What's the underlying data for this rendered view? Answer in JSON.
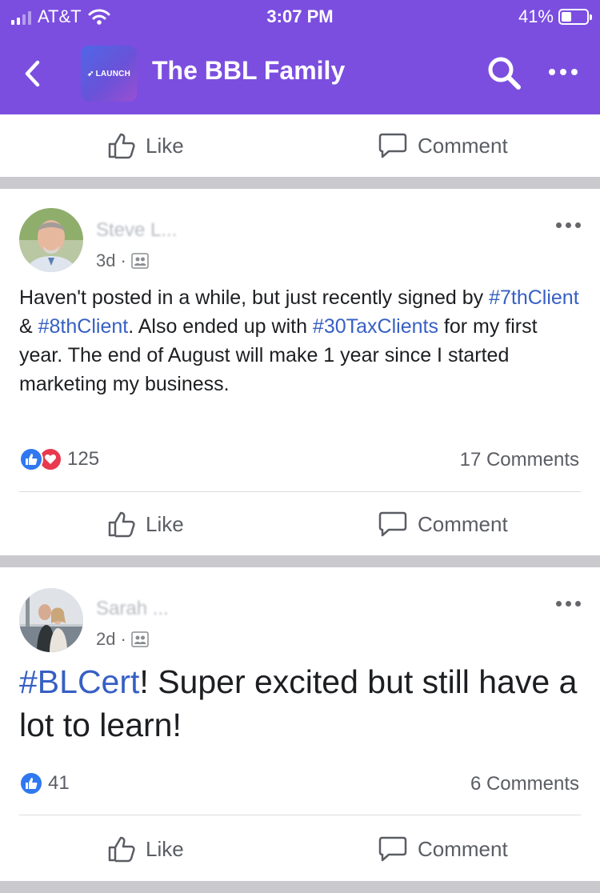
{
  "status_bar": {
    "carrier": "AT&T",
    "time": "3:07 PM",
    "battery_percent": "41%",
    "battery_level": 0.41,
    "signal_bars_active": 2,
    "icons": [
      "signal-icon",
      "wifi-icon",
      "battery-icon"
    ]
  },
  "nav": {
    "group_name": "The BBL Family",
    "group_avatar_text": "LAUNCH",
    "icons": [
      "back-chevron-icon",
      "search-icon",
      "more-icon"
    ]
  },
  "colors": {
    "header": "#7b4ee0",
    "hashtag": "#365fc4",
    "like_reaction": "#2f78f0",
    "love_reaction": "#e8394f",
    "separator": "#c9c9ce"
  },
  "actions": {
    "like": "Like",
    "comment": "Comment"
  },
  "posts": [
    {
      "author": "Steve L...",
      "time": "3d",
      "separator": "·",
      "privacy": "group-members-icon",
      "text_segments": [
        {
          "text": "Haven't posted in a while, but just recently signed by ",
          "hashtag": false
        },
        {
          "text": "#7thClient",
          "hashtag": true
        },
        {
          "text": " & ",
          "hashtag": false
        },
        {
          "text": "#8thClient",
          "hashtag": true
        },
        {
          "text": ".  Also ended up with ",
          "hashtag": false
        },
        {
          "text": "#30TaxClients",
          "hashtag": true
        },
        {
          "text": " for my first year.  The end of August will make 1 year since I started marketing my business.",
          "hashtag": false
        }
      ],
      "reactions": [
        "like",
        "love"
      ],
      "reaction_count": "125",
      "comments": "17 Comments"
    },
    {
      "author": "Sarah ...",
      "time": "2d",
      "separator": "·",
      "privacy": "group-members-icon",
      "text_segments": [
        {
          "text": "#BLCert",
          "hashtag": true
        },
        {
          "text": "! Super excited but still have a lot to learn!",
          "hashtag": false
        }
      ],
      "reactions": [
        "like"
      ],
      "reaction_count": "41",
      "comments": "6 Comments"
    }
  ]
}
